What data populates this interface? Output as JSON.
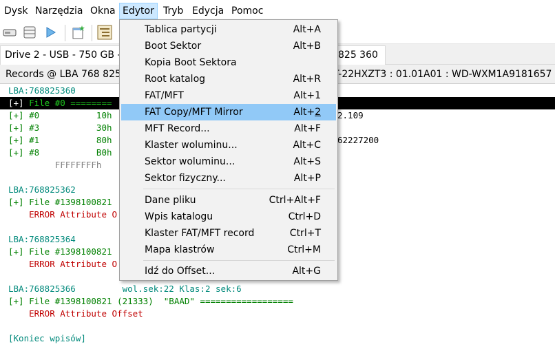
{
  "menubar": {
    "items": [
      "Dysk",
      "Narzędzia",
      "Okna",
      "Edytor",
      "Tryb",
      "Edycja",
      "Pomoc"
    ],
    "active": "Edytor"
  },
  "toolbar": {
    "icons": [
      "drive-icon",
      "list-icon",
      "play-icon",
      "new-window-icon",
      "tree-view-icon"
    ]
  },
  "drive_tab": {
    "label": "Drive 2 - USB - 750 GB - V",
    "tail": "825 360"
  },
  "records_bar": {
    "left": "Records @ LBA 768 825 3",
    "right": "T-22HXZT3 : 01.01A01 : WD-WXM1A9181657"
  },
  "content": {
    "lines": [
      {
        "text": "LBA:768825360",
        "color": "teal"
      },
      {
        "selected_bracket": "[+]",
        "selected_text": " File #0 ========"
      },
      {
        "text": "[+] #0           10h",
        "color": "green",
        "tail": "2.109"
      },
      {
        "text": "[+] #3           30h",
        "color": "green"
      },
      {
        "text": "[+] #1           80h",
        "color": "green",
        "tail": "62227200"
      },
      {
        "text": "[+] #8           B0h",
        "color": "green"
      },
      {
        "text": "         FFFFFFFFh",
        "color": "grey"
      },
      {
        "text": "",
        "color": "dark"
      },
      {
        "text": "LBA:768825362",
        "color": "teal"
      },
      {
        "text": "[+] File #1398100821",
        "color": "green"
      },
      {
        "text": "    ERROR Attribute O",
        "color": "red"
      },
      {
        "text": "",
        "color": "dark"
      },
      {
        "text": "LBA:768825364",
        "color": "teal"
      },
      {
        "text": "[+] File #1398100821",
        "color": "green"
      },
      {
        "text": "    ERROR Attribute O",
        "color": "red"
      },
      {
        "text": "",
        "color": "dark"
      },
      {
        "text": "LBA:768825366         wol.sek:22 Klas:2 sek:6",
        "color": "teal"
      },
      {
        "text": "[+] File #1398100821 (21333)  \"BAAD\" ==================",
        "color": "green"
      },
      {
        "text": "    ERROR Attribute Offset",
        "color": "red"
      },
      {
        "text": "",
        "color": "dark"
      },
      {
        "text": "[Koniec wpisów]",
        "color": "teal"
      }
    ]
  },
  "dropdown": {
    "items": [
      {
        "label": "Tablica partycji",
        "shortcut": "Alt+A"
      },
      {
        "label": "Boot Sektor",
        "shortcut": "Alt+B"
      },
      {
        "label": "Kopia Boot Sektora",
        "shortcut": ""
      },
      {
        "label": "Root katalog",
        "shortcut": "Alt+R"
      },
      {
        "label": "FAT/MFT",
        "shortcut": "Alt+1"
      },
      {
        "label": "FAT Copy/MFT Mirror",
        "shortcut_pre": "Alt+",
        "shortcut_key": "2",
        "highlighted": true
      },
      {
        "label": "MFT Record...",
        "shortcut": "Alt+F"
      },
      {
        "label": "Klaster woluminu...",
        "shortcut": "Alt+C"
      },
      {
        "label": "Sektor woluminu...",
        "shortcut": "Alt+S"
      },
      {
        "label": "Sektor fizyczny...",
        "shortcut": "Alt+P"
      },
      {
        "label": "Dane pliku",
        "shortcut": "Ctrl+Alt+F"
      },
      {
        "label": "Wpis katalogu",
        "shortcut": "Ctrl+D"
      },
      {
        "label": "Klaster FAT/MFT record",
        "shortcut": "Ctrl+T"
      },
      {
        "label": "Mapa klastrów",
        "shortcut": "Ctrl+M"
      },
      {
        "label": "Idź do Offset...",
        "shortcut": "Alt+G"
      }
    ]
  },
  "colors": {
    "highlight": "#91c9f7",
    "menu_active": "#cce8ff",
    "teal": "#00897b",
    "green": "#008000",
    "red": "#c00000"
  }
}
